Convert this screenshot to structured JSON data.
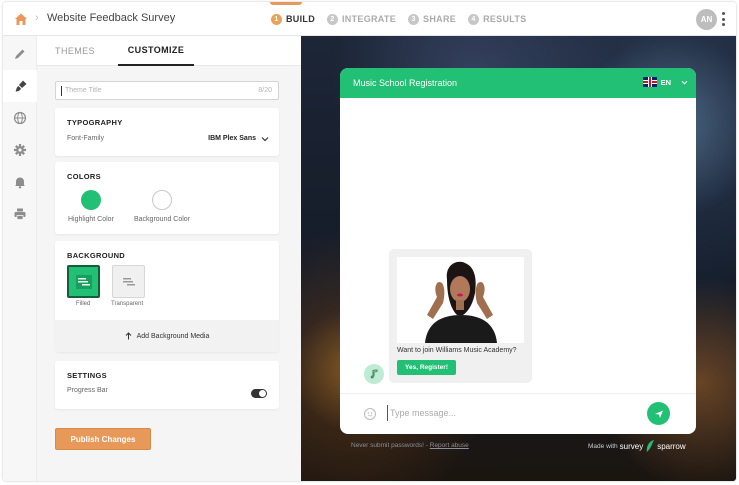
{
  "topbar": {
    "survey_name": "Website Feedback Survey",
    "steps": [
      {
        "num": "1",
        "label": "BUILD"
      },
      {
        "num": "2",
        "label": "INTEGRATE"
      },
      {
        "num": "3",
        "label": "SHARE"
      },
      {
        "num": "4",
        "label": "RESULTS"
      }
    ],
    "avatar_initials": "AN"
  },
  "rail": [
    "pencil-icon",
    "brush-icon",
    "globe-icon",
    "gear-icon",
    "bell-icon",
    "printer-icon"
  ],
  "panel": {
    "tabs": [
      "THEMES",
      "CUSTOMIZE"
    ],
    "theme_title_placeholder": "Theme Title",
    "theme_title_count": "8/20",
    "typography": {
      "title": "TYPOGRAPHY",
      "label": "Font-Family",
      "value": "IBM Plex Sans"
    },
    "colors": {
      "title": "COLORS",
      "highlight_label": "Highlight Color",
      "background_label": "Background Color",
      "highlight": "#22c074",
      "background": "#ffffff"
    },
    "background": {
      "title": "BACKGROUND",
      "filled_label": "Filled",
      "transparent_label": "Transparent",
      "add_media": "Add Background Media"
    },
    "settings": {
      "title": "SETTINGS",
      "progress_bar_label": "Progress Bar"
    },
    "publish_label": "Publish Changes"
  },
  "preview": {
    "chat_title": "Music School Registration",
    "language": "EN",
    "question": "Want to join Williams Music Academy?",
    "answer_button": "Yes, Register!",
    "composer_placeholder": "Type message...",
    "footer_left_prefix": "Never submit passwords! - ",
    "footer_left_link": "Report abuse",
    "footer_right_prefix": "Made with",
    "footer_right_brand_a": "survey",
    "footer_right_brand_b": "sparrow"
  },
  "colors": {
    "accent_orange": "#e8995a",
    "brand_green": "#22c074"
  }
}
